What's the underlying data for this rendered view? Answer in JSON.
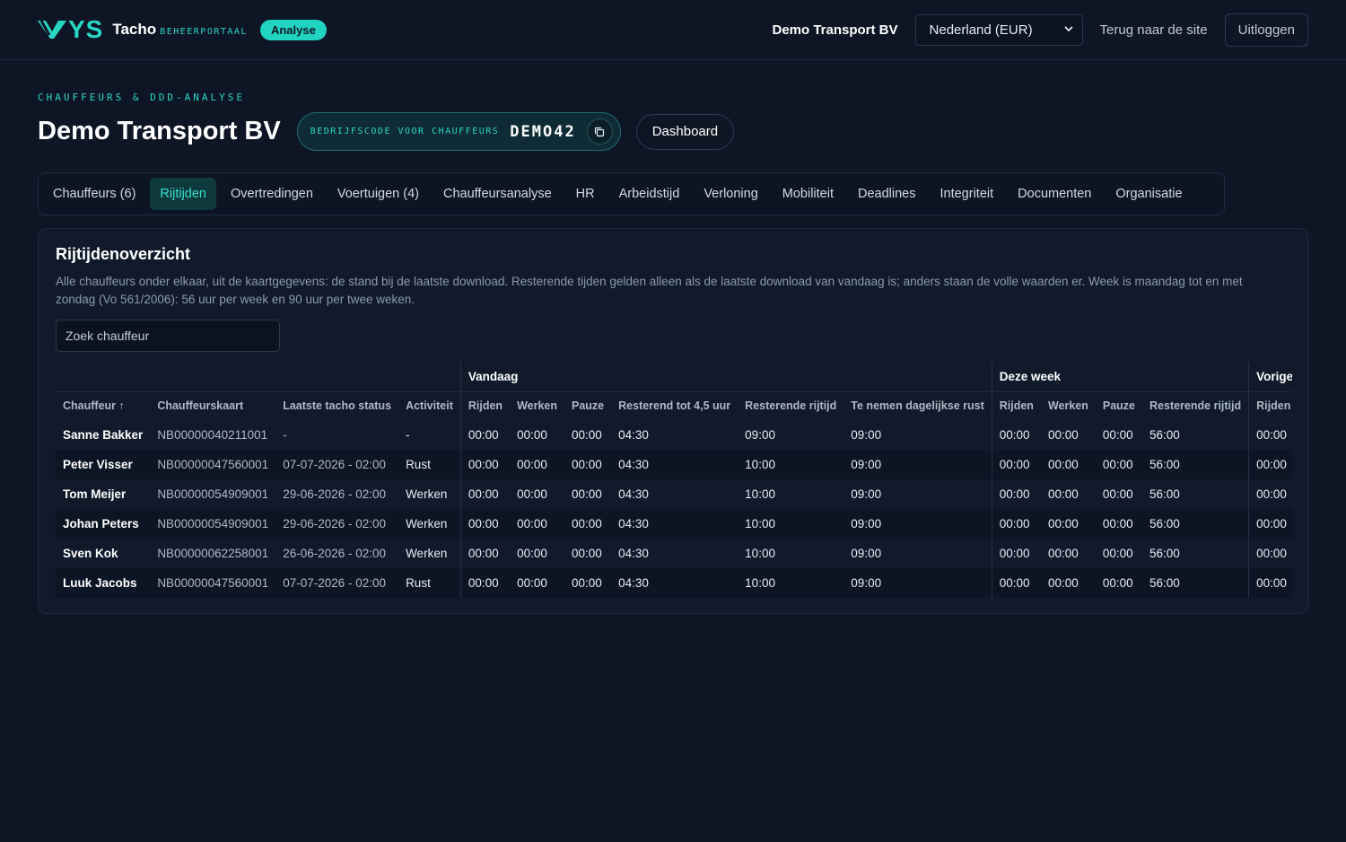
{
  "header": {
    "logo_text": "YS",
    "brand": "Tacho",
    "brand_sub": "BEHEERPORTAAL",
    "badge": "Analyse",
    "company": "Demo Transport BV",
    "country_selected": "Nederland (EUR)",
    "back_link": "Terug naar de site",
    "logout": "Uitloggen"
  },
  "page": {
    "eyebrow": "CHAUFFEURS & DDD-ANALYSE",
    "title": "Demo Transport BV",
    "code_label": "BEDRIJFSCODE VOOR CHAUFFEURS",
    "code_value": "DEMO42",
    "dashboard": "Dashboard"
  },
  "tabs": [
    {
      "label": "Chauffeurs (6)",
      "active": false
    },
    {
      "label": "Rijtijden",
      "active": true
    },
    {
      "label": "Overtredingen",
      "active": false
    },
    {
      "label": "Voertuigen (4)",
      "active": false
    },
    {
      "label": "Chauffeursanalyse",
      "active": false
    },
    {
      "label": "HR",
      "active": false
    },
    {
      "label": "Arbeidstijd",
      "active": false
    },
    {
      "label": "Verloning",
      "active": false
    },
    {
      "label": "Mobiliteit",
      "active": false
    },
    {
      "label": "Deadlines",
      "active": false
    },
    {
      "label": "Integriteit",
      "active": false
    },
    {
      "label": "Documenten",
      "active": false
    },
    {
      "label": "Organisatie",
      "active": false
    }
  ],
  "card": {
    "title": "Rijtijdenoverzicht",
    "description": "Alle chauffeurs onder elkaar, uit de kaartgegevens: de stand bij de laatste download. Resterende tijden gelden alleen als de laatste download van vandaag is; anders staan de volle waarden er. Week is maandag tot en met zondag (Vo 561/2006): 56 uur per week en 90 uur per twee weken.",
    "search_placeholder": "Zoek chauffeur"
  },
  "table": {
    "groups": {
      "today": "Vandaag",
      "week": "Deze week",
      "prev_week": "Vorige week"
    },
    "columns": [
      "Chauffeur ↑",
      "Chauffeurskaart",
      "Laatste tacho status",
      "Activiteit",
      "Rijden",
      "Werken",
      "Pauze",
      "Resterend tot 4,5 uur",
      "Resterende rijtijd",
      "Te nemen dagelijkse rust",
      "Rijden",
      "Werken",
      "Pauze",
      "Resterende rijtijd",
      "Rijden"
    ],
    "rows": [
      [
        "Sanne Bakker",
        "NB00000040211001",
        "-",
        "-",
        "00:00",
        "00:00",
        "00:00",
        "04:30",
        "09:00",
        "09:00",
        "00:00",
        "00:00",
        "00:00",
        "56:00",
        "00:00"
      ],
      [
        "Peter Visser",
        "NB00000047560001",
        "07-07-2026 - 02:00",
        "Rust",
        "00:00",
        "00:00",
        "00:00",
        "04:30",
        "10:00",
        "09:00",
        "00:00",
        "00:00",
        "00:00",
        "56:00",
        "00:00"
      ],
      [
        "Tom Meijer",
        "NB00000054909001",
        "29-06-2026 - 02:00",
        "Werken",
        "00:00",
        "00:00",
        "00:00",
        "04:30",
        "10:00",
        "09:00",
        "00:00",
        "00:00",
        "00:00",
        "56:00",
        "00:00"
      ],
      [
        "Johan Peters",
        "NB00000054909001",
        "29-06-2026 - 02:00",
        "Werken",
        "00:00",
        "00:00",
        "00:00",
        "04:30",
        "10:00",
        "09:00",
        "00:00",
        "00:00",
        "00:00",
        "56:00",
        "00:00"
      ],
      [
        "Sven Kok",
        "NB00000062258001",
        "26-06-2026 - 02:00",
        "Werken",
        "00:00",
        "00:00",
        "00:00",
        "04:30",
        "10:00",
        "09:00",
        "00:00",
        "00:00",
        "00:00",
        "56:00",
        "00:00"
      ],
      [
        "Luuk Jacobs",
        "NB00000047560001",
        "07-07-2026 - 02:00",
        "Rust",
        "00:00",
        "00:00",
        "00:00",
        "04:30",
        "10:00",
        "09:00",
        "00:00",
        "00:00",
        "00:00",
        "56:00",
        "00:00"
      ]
    ]
  }
}
